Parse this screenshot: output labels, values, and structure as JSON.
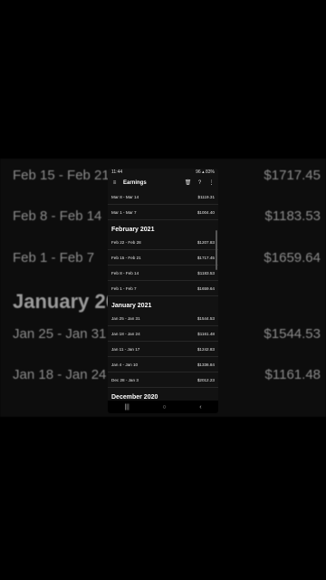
{
  "background": {
    "rows_top": [
      {
        "range": "Feb 15 - Feb 21",
        "amount": "$1717.45"
      },
      {
        "range": "Feb 8 - Feb 14",
        "amount": "$1183.53"
      },
      {
        "range": "Feb 1 - Feb 7",
        "amount": "$1659.64"
      }
    ],
    "heading": "January 20",
    "rows_bottom": [
      {
        "range": "Jan 25 - Jan 31",
        "amount": "$1544.53"
      },
      {
        "range": "Jan 18 - Jan 24",
        "amount": "$1161.48"
      }
    ]
  },
  "status": {
    "time": "11:44",
    "right": "96 ▴ 83%"
  },
  "appbar": {
    "title": "Earnings",
    "menu_icon": "menu-icon",
    "delete_icon": "trash-icon",
    "help_icon": "help-icon",
    "more_icon": "more-icon"
  },
  "list": [
    {
      "type": "row",
      "range": "Mar 8 - Mar 14",
      "amount": "$1119.31"
    },
    {
      "type": "row",
      "range": "Mar 1 - Mar 7",
      "amount": "$1004.40"
    },
    {
      "type": "section",
      "title": "February 2021"
    },
    {
      "type": "row",
      "range": "Feb 22 - Feb 28",
      "amount": "$1207.83"
    },
    {
      "type": "row",
      "range": "Feb 15 - Feb 21",
      "amount": "$1717.45"
    },
    {
      "type": "row",
      "range": "Feb 8 - Feb 14",
      "amount": "$1183.53"
    },
    {
      "type": "row",
      "range": "Feb 1 - Feb 7",
      "amount": "$1659.64"
    },
    {
      "type": "section",
      "title": "January 2021"
    },
    {
      "type": "row",
      "range": "Jan 25 - Jan 31",
      "amount": "$1544.53"
    },
    {
      "type": "row",
      "range": "Jan 18 - Jan 24",
      "amount": "$1161.48"
    },
    {
      "type": "row",
      "range": "Jan 11 - Jan 17",
      "amount": "$1242.83"
    },
    {
      "type": "row",
      "range": "Jan 4 - Jan 10",
      "amount": "$1336.84"
    },
    {
      "type": "row",
      "range": "Dec 28 - Jan 3",
      "amount": "$2012.23"
    },
    {
      "type": "section",
      "title": "December 2020"
    },
    {
      "type": "row",
      "range": "Dec 21 - Dec 27",
      "amount": "$1988.61"
    }
  ],
  "navbar": {
    "recents": "|||",
    "home": "○",
    "back": "‹"
  }
}
